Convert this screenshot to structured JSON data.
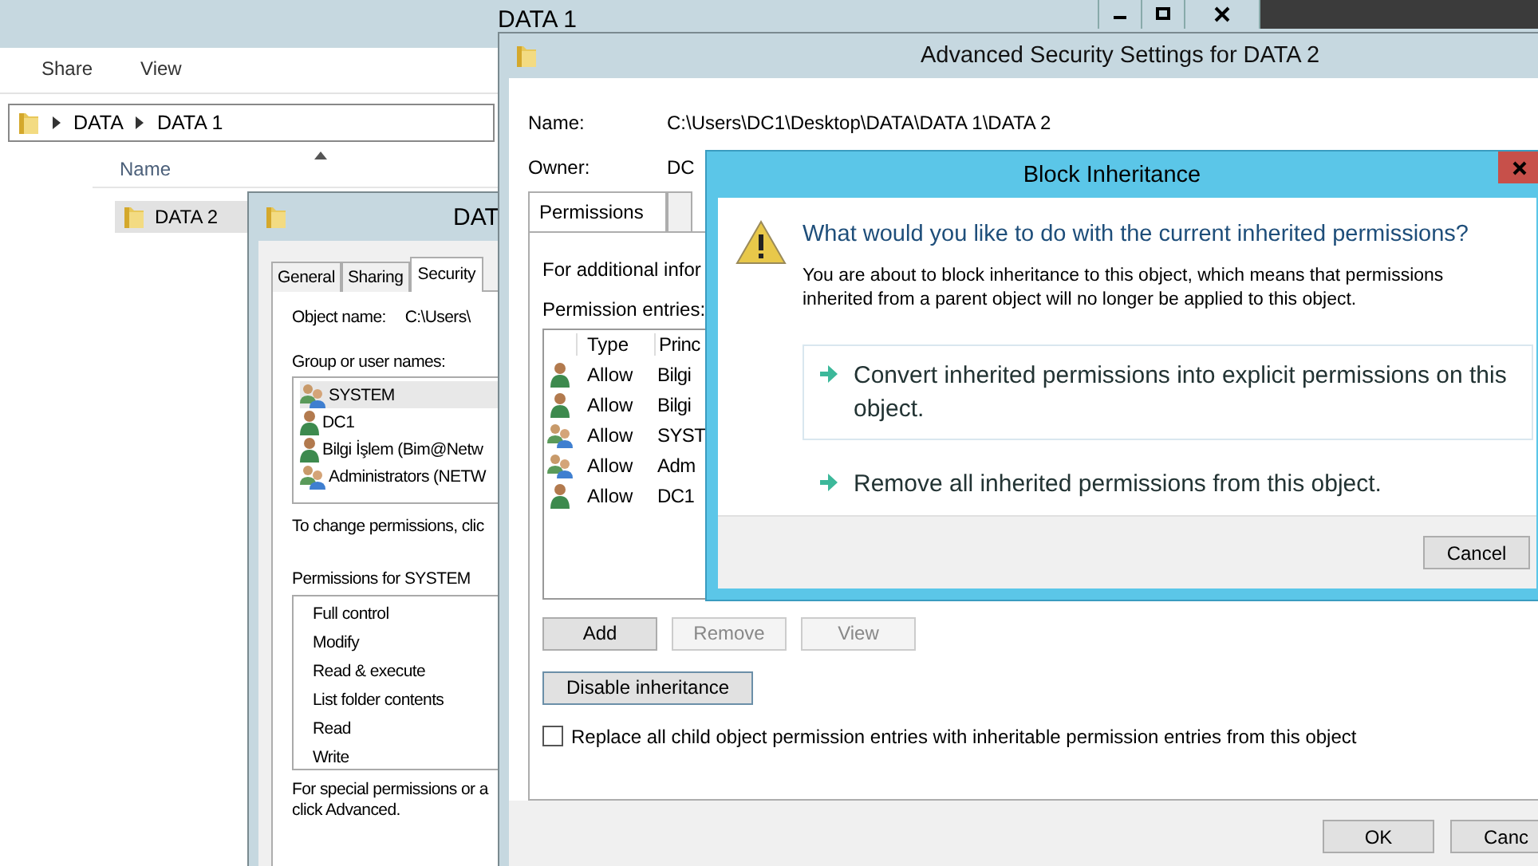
{
  "explorer": {
    "title": "DATA 1",
    "ribbon_tabs": [
      "Share",
      "View"
    ],
    "breadcrumb": [
      "DATA",
      "DATA 1"
    ],
    "columns": [
      "Name"
    ],
    "items": [
      {
        "name": "DATA 2",
        "selected": true
      }
    ]
  },
  "properties": {
    "title": "DAT",
    "tabs": [
      {
        "label": "General",
        "selected": false
      },
      {
        "label": "Sharing",
        "selected": false
      },
      {
        "label": "Security",
        "selected": true
      }
    ],
    "object_name_label": "Object name:",
    "object_name": "C:\\Users\\",
    "group_label": "Group or user names:",
    "users": [
      {
        "name": "SYSTEM",
        "kind": "group",
        "selected": true
      },
      {
        "name": "DC1",
        "kind": "user",
        "selected": false
      },
      {
        "name": "Bilgi İşlem (Bim@Netw",
        "kind": "user",
        "selected": false
      },
      {
        "name": "Administrators (NETW",
        "kind": "group",
        "selected": false
      }
    ],
    "change_hint": "To change permissions, clic",
    "permissions_label": "Permissions for SYSTEM",
    "permissions": [
      "Full control",
      "Modify",
      "Read & execute",
      "List folder contents",
      "Read",
      "Write"
    ],
    "special_hint": [
      "For special permissions or a",
      "click Advanced."
    ]
  },
  "advanced": {
    "title": "Advanced Security Settings for DATA 2",
    "name_label": "Name:",
    "name": "C:\\Users\\DC1\\Desktop\\DATA\\DATA 1\\DATA 2",
    "owner_label": "Owner:",
    "owner": "DC",
    "tabs": [
      {
        "label": "Permissions",
        "selected": true
      }
    ],
    "info_text": "For additional infor",
    "entries_label": "Permission entries:",
    "columns": [
      "Type",
      "Princ"
    ],
    "entries": [
      {
        "kind": "user",
        "type": "Allow",
        "principal": "Bilgi"
      },
      {
        "kind": "user",
        "type": "Allow",
        "principal": "Bilgi"
      },
      {
        "kind": "group",
        "type": "Allow",
        "principal": "SYST"
      },
      {
        "kind": "group",
        "type": "Allow",
        "principal": "Adm"
      },
      {
        "kind": "user",
        "type": "Allow",
        "principal": "DC1"
      }
    ],
    "buttons": [
      {
        "label": "Add",
        "disabled": false
      },
      {
        "label": "Remove",
        "disabled": true
      },
      {
        "label": "View",
        "disabled": true
      }
    ],
    "disable_inheritance": "Disable inheritance",
    "replace_checkbox": {
      "label": "Replace all child object permission entries with inheritable permission entries from this object",
      "checked": false
    },
    "footer_buttons": [
      "OK",
      "Canc"
    ]
  },
  "dialog": {
    "title": "Block Inheritance",
    "heading": "What would you like to do with the current inherited permissions?",
    "description": "You are about to block inheritance to this object, which means that permissions inherited from a parent object will no longer be applied to this object.",
    "options": [
      {
        "label": "Convert inherited permissions into explicit permissions on this object.",
        "selected": true
      },
      {
        "label": "Remove all inherited permissions from this object.",
        "selected": false
      }
    ],
    "cancel": "Cancel"
  }
}
